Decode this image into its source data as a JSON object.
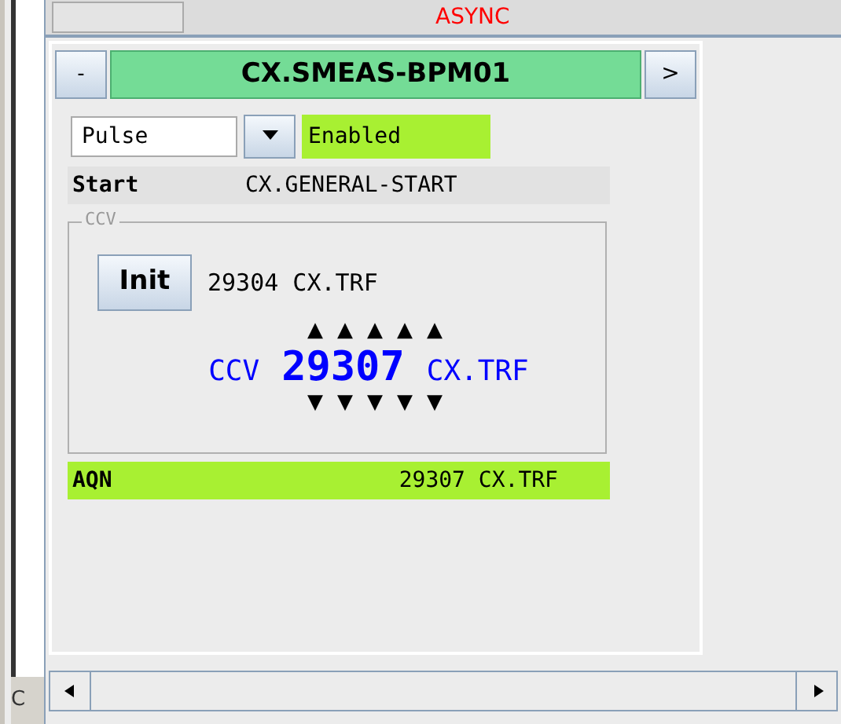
{
  "header": {
    "status": "ASYNC"
  },
  "side_label": "C",
  "device": {
    "collapse_button": "-",
    "name": "CX.SMEAS-BPM01",
    "next_button": ">"
  },
  "mode": {
    "value": "Pulse"
  },
  "state": {
    "text": "Enabled"
  },
  "start": {
    "label": "Start",
    "value": "CX.GENERAL-START"
  },
  "ccv": {
    "group_title": "CCV",
    "init_button": "Init",
    "init_value": "29304 CX.TRF",
    "label": "CCV",
    "value": "29307",
    "unit": "CX.TRF",
    "up_arrows": [
      "▲",
      "▲",
      "▲",
      "▲",
      "▲"
    ],
    "down_arrows": [
      "▼",
      "▼",
      "▼",
      "▼",
      "▼"
    ]
  },
  "aqn": {
    "label": "AQN",
    "value": "29307 CX.TRF"
  }
}
